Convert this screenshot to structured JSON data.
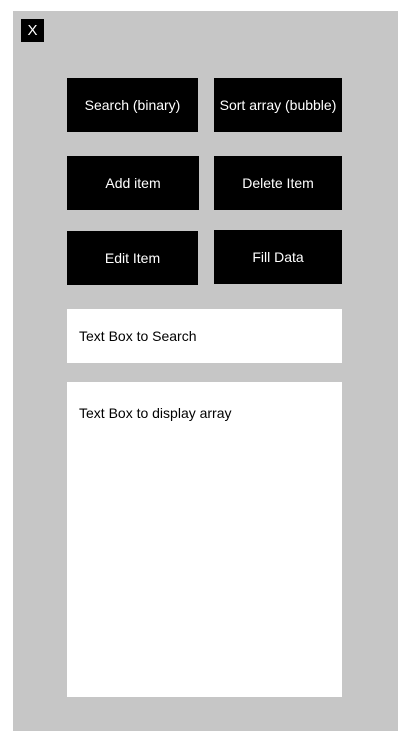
{
  "close_button": {
    "label": "X"
  },
  "buttons": {
    "search_binary": "Search (binary)",
    "sort_bubble": "Sort array (bubble)",
    "add_item": "Add item",
    "delete_item": "Delete Item",
    "edit_item": "Edit Item",
    "fill_data": "Fill Data"
  },
  "search_box": {
    "text": "Text Box to Search"
  },
  "array_box": {
    "text": "Text Box to display array"
  },
  "colors": {
    "frame_background": "#c6c6c6",
    "button_background": "#000000",
    "button_text": "#ffffff",
    "textbox_background": "#ffffff"
  }
}
